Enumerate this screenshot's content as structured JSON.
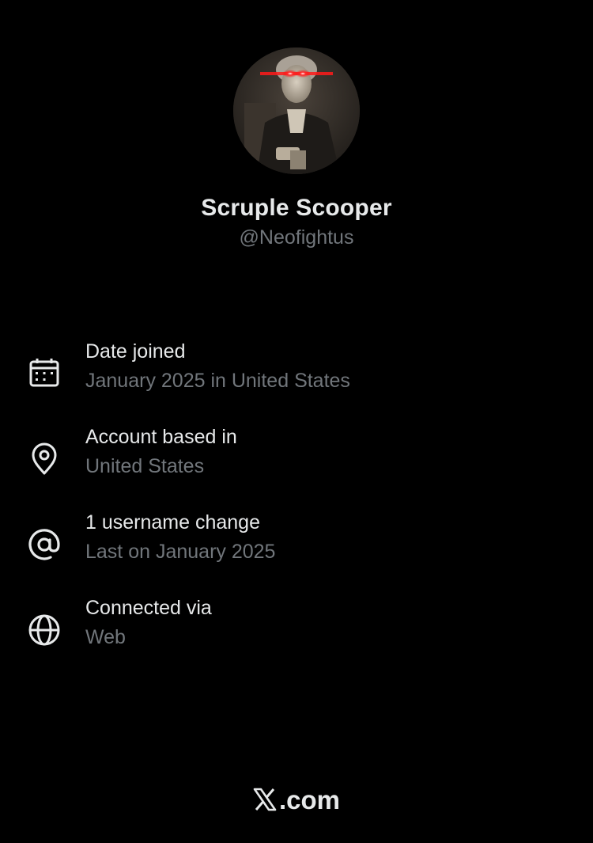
{
  "profile": {
    "display_name": "Scruple Scooper",
    "handle": "@Neofightus",
    "avatar_icon": "portrait-avatar-with-red-laser-eyes"
  },
  "info": [
    {
      "icon": "calendar-icon",
      "title": "Date joined",
      "subtitle": "January 2025 in United States"
    },
    {
      "icon": "location-pin-icon",
      "title": "Account based in",
      "subtitle": "United States"
    },
    {
      "icon": "at-sign-icon",
      "title": "1 username change",
      "subtitle": "Last on January 2025"
    },
    {
      "icon": "globe-icon",
      "title": "Connected via",
      "subtitle": "Web"
    }
  ],
  "footer": {
    "logo_icon": "x-logo-icon",
    "domain": ".com"
  },
  "colors": {
    "background": "#000000",
    "primary_text": "#e7e9ea",
    "secondary_text": "#71767b",
    "laser_red": "#ff1a1a"
  }
}
